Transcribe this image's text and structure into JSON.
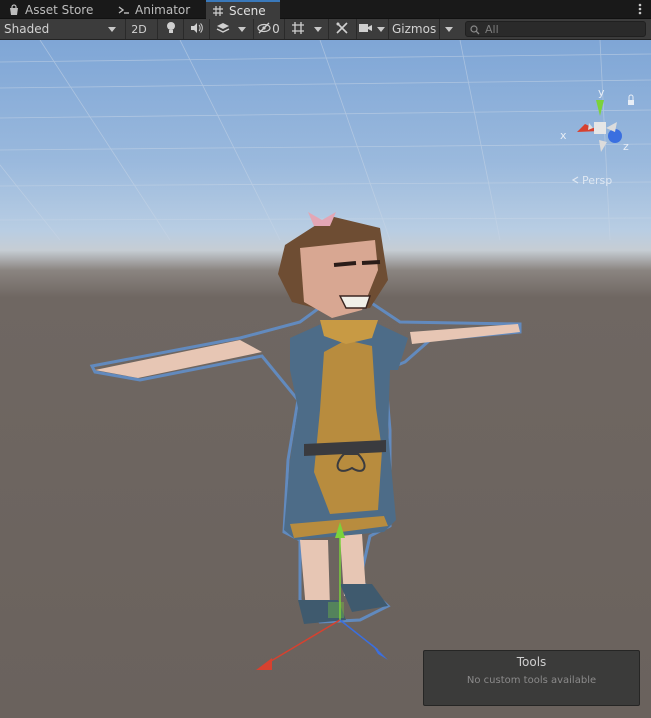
{
  "tabs": [
    {
      "label": "Asset Store",
      "icon": "shopping-bag-icon",
      "active": false
    },
    {
      "label": "Animator",
      "icon": "animator-icon",
      "active": false
    },
    {
      "label": "Scene",
      "icon": "grid-icon",
      "active": true
    }
  ],
  "toolbar": {
    "draw_mode": "Shaded",
    "mode_2d": "2D",
    "hidden_count": "0",
    "gizmos_label": "Gizmos",
    "search_placeholder": "All"
  },
  "scene_gizmo": {
    "x_label": "x",
    "y_label": "y",
    "z_label": "z",
    "projection": "Persp",
    "colors": {
      "x": "#d7412f",
      "y": "#7ad23a",
      "z": "#3a6fe0"
    }
  },
  "tools_overlay": {
    "title": "Tools",
    "message": "No custom tools available"
  }
}
